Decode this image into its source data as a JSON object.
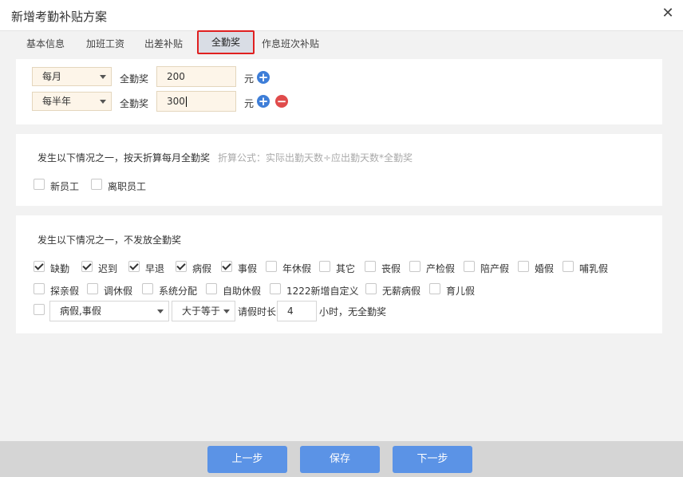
{
  "dialog": {
    "title": "新增考勤补贴方案",
    "close_icon": "close-icon"
  },
  "tabs": [
    {
      "label": "基本信息"
    },
    {
      "label": "加班工资"
    },
    {
      "label": "出差补贴"
    },
    {
      "label": "全勤奖",
      "active": true
    },
    {
      "label": "作息班次补贴"
    }
  ],
  "bonus_rows": [
    {
      "period": "每月",
      "label": "全勤奖",
      "amount": "200",
      "unit": "元"
    },
    {
      "period": "每半年",
      "label": "全勤奖",
      "amount": "300",
      "unit": "元"
    }
  ],
  "prorate": {
    "heading": "发生以下情况之一，按天折算每月全勤奖",
    "formula": "折算公式：实际出勤天数÷应出勤天数*全勤奖",
    "options": [
      {
        "label": "新员工",
        "checked": false
      },
      {
        "label": "离职员工",
        "checked": false
      }
    ]
  },
  "no_bonus": {
    "heading": "发生以下情况之一，不发放全勤奖",
    "options": [
      {
        "label": "缺勤",
        "checked": true
      },
      {
        "label": "迟到",
        "checked": true
      },
      {
        "label": "早退",
        "checked": true
      },
      {
        "label": "病假",
        "checked": true
      },
      {
        "label": "事假",
        "checked": true
      },
      {
        "label": "年休假",
        "checked": false
      },
      {
        "label": "其它",
        "checked": false
      },
      {
        "label": "丧假",
        "checked": false
      },
      {
        "label": "产检假",
        "checked": false
      },
      {
        "label": "陪产假",
        "checked": false
      },
      {
        "label": "婚假",
        "checked": false
      },
      {
        "label": "哺乳假",
        "checked": false
      },
      {
        "label": "探亲假",
        "checked": false
      },
      {
        "label": "调休假",
        "checked": false
      },
      {
        "label": "系统分配",
        "checked": false
      },
      {
        "label": "自助休假",
        "checked": false
      },
      {
        "label": "1222新增自定义",
        "checked": false
      },
      {
        "label": "无薪病假",
        "checked": false
      },
      {
        "label": "育儿假",
        "checked": false
      }
    ],
    "rule": {
      "checked": false,
      "leave_types": "病假,事假",
      "operator": "大于等于",
      "label": "请假时长",
      "hours": "4",
      "suffix": "小时，无全勤奖"
    }
  },
  "footer": {
    "prev": "上一步",
    "save": "保存",
    "next": "下一步"
  },
  "colors": {
    "primary_button": "#5b93e6",
    "active_tab_border": "#e02020",
    "add_icon": "#3e7ed8",
    "remove_icon": "#e04b4b"
  }
}
